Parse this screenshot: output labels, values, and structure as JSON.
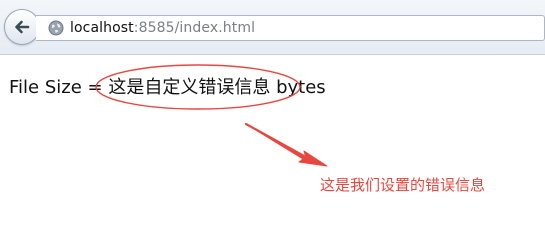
{
  "browser": {
    "url_host": "localhost",
    "url_rest": ":8585/index.html"
  },
  "page": {
    "label": "File Size",
    "equals": "=",
    "error_message": "这是自定义错误信息",
    "unit": "bytes"
  },
  "annotation": {
    "text": "这是我们设置的错误信息",
    "color": "#e8473f"
  },
  "icons": {
    "back": "back-arrow-icon",
    "site": "globe-icon"
  }
}
